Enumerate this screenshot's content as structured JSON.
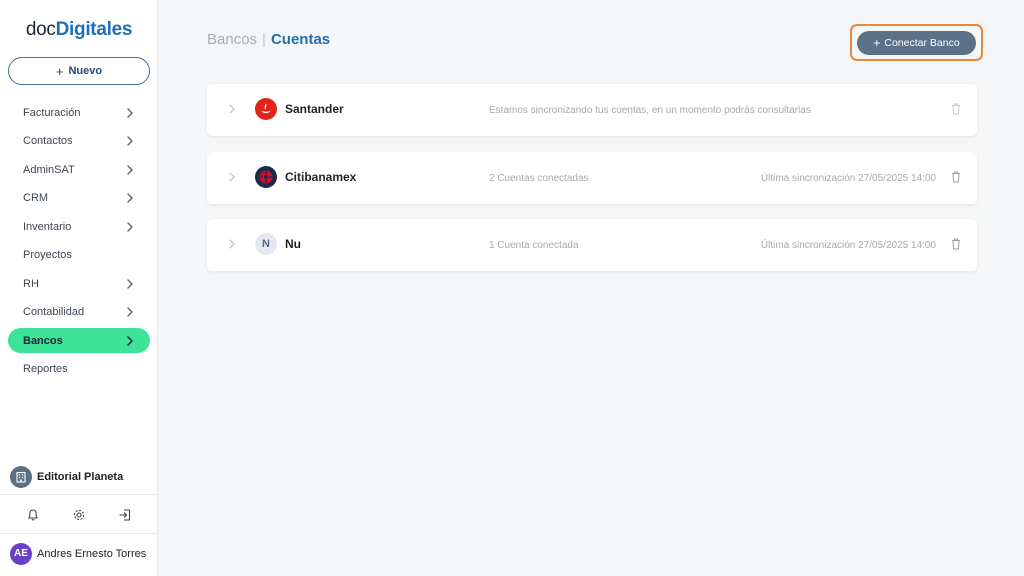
{
  "logo": {
    "part1": "doc",
    "part2": "Digitales"
  },
  "sidebar": {
    "new_button": "Nuevo",
    "items": [
      {
        "label": "Facturación",
        "chevron": true,
        "active": false
      },
      {
        "label": "Contactos",
        "chevron": true,
        "active": false
      },
      {
        "label": "AdminSAT",
        "chevron": true,
        "active": false
      },
      {
        "label": "CRM",
        "chevron": true,
        "active": false
      },
      {
        "label": "Inventario",
        "chevron": true,
        "active": false
      },
      {
        "label": "Proyectos",
        "chevron": false,
        "active": false
      },
      {
        "label": "RH",
        "chevron": true,
        "active": false
      },
      {
        "label": "Contabilidad",
        "chevron": true,
        "active": false
      },
      {
        "label": "Bancos",
        "chevron": true,
        "active": true
      },
      {
        "label": "Reportes",
        "chevron": false,
        "active": false
      }
    ],
    "company": "Editorial Planeta",
    "bottom_icons": [
      "bell-icon",
      "gear-icon",
      "logout-icon"
    ],
    "user": {
      "initials": "AE",
      "name": "Andres Ernesto Torres"
    }
  },
  "breadcrumb": {
    "parent": "Bancos",
    "separator": "|",
    "current": "Cuentas"
  },
  "header": {
    "connect_button": "Conectar Banco"
  },
  "banks": [
    {
      "name": "Santander",
      "logo": "santander-logo",
      "status": "Estamos sincronizando tus cuentas, en un momento podrás consultarlas",
      "sync": ""
    },
    {
      "name": "Citibanamex",
      "logo": "citibanamex-logo",
      "status": "2 Cuentas conectadas",
      "sync": "Última sincronización 27/05/2025 14:00"
    },
    {
      "name": "Nu",
      "logo": "nu-logo",
      "logo_letter": "N",
      "status": "1 Cuenta conectada",
      "sync": "Última sincronización 27/05/2025 14:00"
    }
  ],
  "colors": {
    "accent": "#1f6fb2",
    "active_nav": "#3ee39a",
    "connect_button": "#5a7188",
    "highlight_outline": "#e8883a",
    "avatar": "#6b3fc7",
    "santander": "#e2231a",
    "citibanamex": "#1b2b4a"
  }
}
